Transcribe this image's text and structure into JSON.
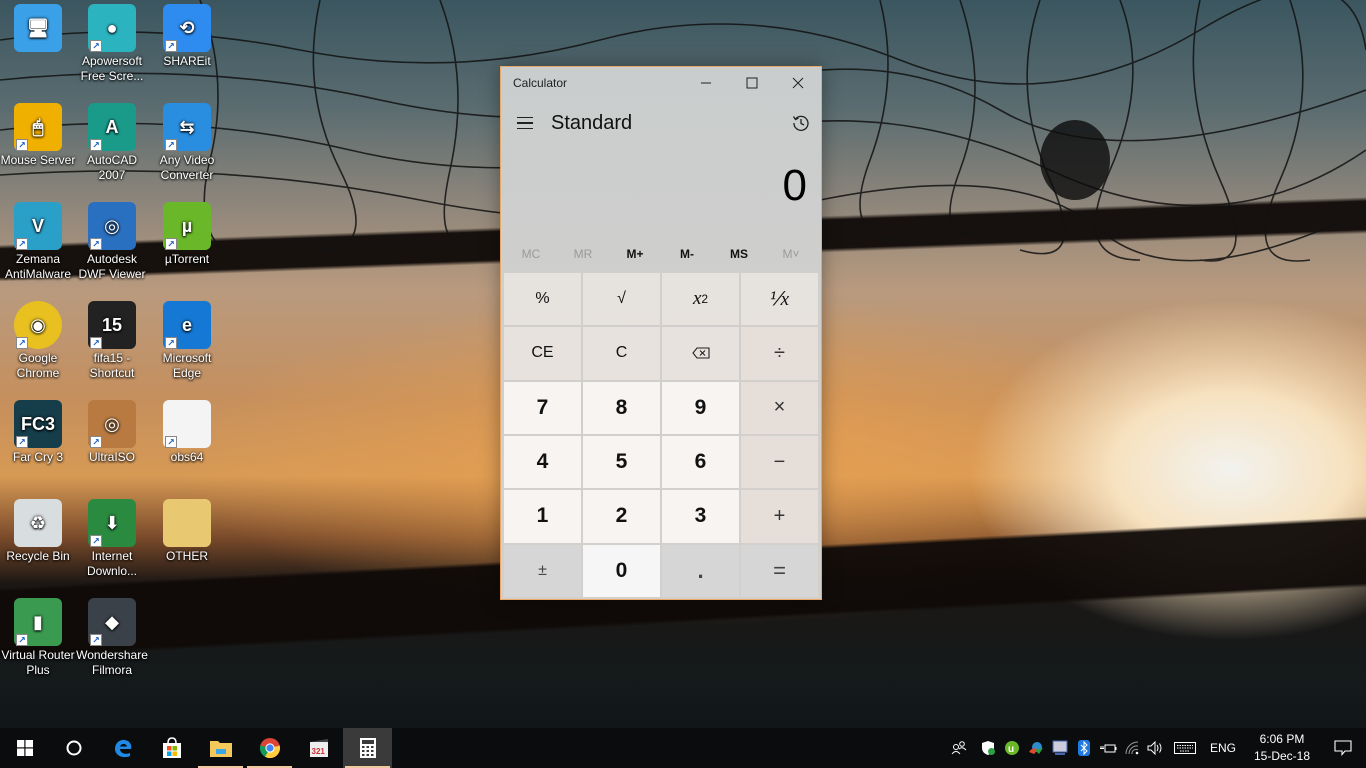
{
  "desktop": {
    "icons": [
      {
        "label": "",
        "name": "this-pc",
        "color": "#3aa0e8"
      },
      {
        "label": "Apowersoft Free Scre...",
        "name": "apowersoft",
        "color": "#2bb3c0"
      },
      {
        "label": "SHAREit",
        "name": "shareit",
        "color": "#2e8cf0"
      },
      {
        "label": "Mouse Server",
        "name": "mouse-server",
        "color": "#f0b000"
      },
      {
        "label": "AutoCAD 2007",
        "name": "autocad",
        "color": "#1a9b8a"
      },
      {
        "label": "Any Video Converter",
        "name": "any-video-converter",
        "color": "#2a8ee0"
      },
      {
        "label": "Zemana AntiMalware",
        "name": "zemana",
        "color": "#2aa0c8"
      },
      {
        "label": "Autodesk DWF Viewer",
        "name": "dwf-viewer",
        "color": "#2a70c0"
      },
      {
        "label": "µTorrent",
        "name": "utorrent",
        "color": "#6ab82a"
      },
      {
        "label": "Google Chrome",
        "name": "chrome",
        "color": "#e8c020"
      },
      {
        "label": "fifa15 - Shortcut",
        "name": "fifa15",
        "color": "#222"
      },
      {
        "label": "Microsoft Edge",
        "name": "edge",
        "color": "#1478d4"
      },
      {
        "label": "Far Cry 3",
        "name": "far-cry-3",
        "color": "#163d4a"
      },
      {
        "label": "UltraISO",
        "name": "ultraiso",
        "color": "#b87a40"
      },
      {
        "label": "obs64",
        "name": "obs64",
        "color": "#f4f4f4"
      },
      {
        "label": "Recycle Bin",
        "name": "recycle-bin",
        "color": "#d8dde0"
      },
      {
        "label": "Internet Downlo...",
        "name": "idm",
        "color": "#2a8a40"
      },
      {
        "label": "OTHER",
        "name": "other-folder",
        "color": "#e8c870"
      },
      {
        "label": "Virtual Router Plus",
        "name": "virtual-router",
        "color": "#3a9a50"
      },
      {
        "label": "Wondershare Filmora",
        "name": "filmora",
        "color": "#3a4148"
      }
    ],
    "icon_glyphs": [
      "🖥",
      "●",
      "⟲",
      "🖱",
      "A",
      "⇆",
      "V",
      "◎",
      "µ",
      "◉",
      "15",
      "e",
      "FC3",
      "◎",
      "",
      "♻",
      "⬇",
      "",
      "▮",
      "◆"
    ]
  },
  "calculator": {
    "title": "Calculator",
    "mode": "Standard",
    "display": "0",
    "window_buttons": {
      "minimize": "—",
      "maximize": "☐",
      "close": "✕"
    },
    "memory": [
      "MC",
      "MR",
      "M+",
      "M-",
      "MS",
      "M˅"
    ],
    "keys": {
      "percent": "%",
      "sqrt": "√",
      "square_base": "x",
      "square_exp": "2",
      "reciprocal": "⅟x",
      "ce": "CE",
      "c": "C",
      "backspace": "⌫",
      "divide": "÷",
      "seven": "7",
      "eight": "8",
      "nine": "9",
      "multiply": "×",
      "four": "4",
      "five": "5",
      "six": "6",
      "minus": "−",
      "one": "1",
      "two": "2",
      "three": "3",
      "plus": "+",
      "negate": "±",
      "zero": "0",
      "decimal": ".",
      "equals": "="
    }
  },
  "taskbar": {
    "tray": {
      "language": "ENG",
      "time": "6:06 PM",
      "date": "15-Dec-18"
    }
  }
}
